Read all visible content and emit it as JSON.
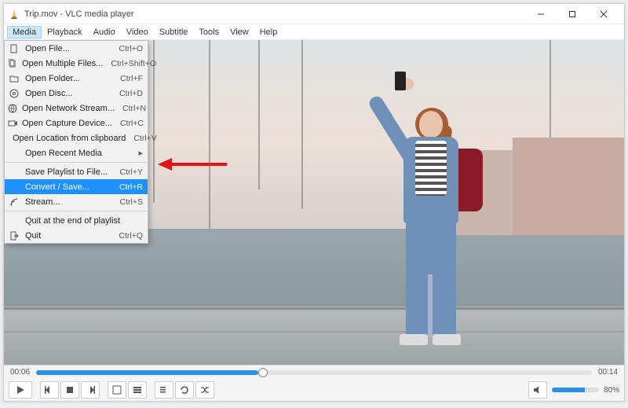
{
  "title": "Trip.mov - VLC media player",
  "menubar": [
    "Media",
    "Playback",
    "Audio",
    "Video",
    "Subtitle",
    "Tools",
    "View",
    "Help"
  ],
  "menubar_active_index": 0,
  "dropdown": {
    "groups": [
      [
        {
          "icon": "file-icon",
          "label": "Open File...",
          "shortcut": "Ctrl+O"
        },
        {
          "icon": "files-icon",
          "label": "Open Multiple Files...",
          "shortcut": "Ctrl+Shift+O"
        },
        {
          "icon": "folder-icon",
          "label": "Open Folder...",
          "shortcut": "Ctrl+F"
        },
        {
          "icon": "disc-icon",
          "label": "Open Disc...",
          "shortcut": "Ctrl+D"
        },
        {
          "icon": "network-icon",
          "label": "Open Network Stream...",
          "shortcut": "Ctrl+N"
        },
        {
          "icon": "capture-icon",
          "label": "Open Capture Device...",
          "shortcut": "Ctrl+C"
        },
        {
          "icon": "",
          "label": "Open Location from clipboard",
          "shortcut": "Ctrl+V"
        },
        {
          "icon": "",
          "label": "Open Recent Media",
          "shortcut": "",
          "submenu": true
        }
      ],
      [
        {
          "icon": "",
          "label": "Save Playlist to File...",
          "shortcut": "Ctrl+Y"
        },
        {
          "icon": "",
          "label": "Convert / Save...",
          "shortcut": "Ctrl+R",
          "selected": true
        },
        {
          "icon": "stream-icon",
          "label": "Stream...",
          "shortcut": "Ctrl+S"
        }
      ],
      [
        {
          "icon": "",
          "label": "Quit at the end of playlist",
          "shortcut": ""
        },
        {
          "icon": "quit-icon",
          "label": "Quit",
          "shortcut": "Ctrl+Q"
        }
      ]
    ]
  },
  "time": {
    "current": "00:06",
    "total": "00:14"
  },
  "volume_pct": "80%"
}
